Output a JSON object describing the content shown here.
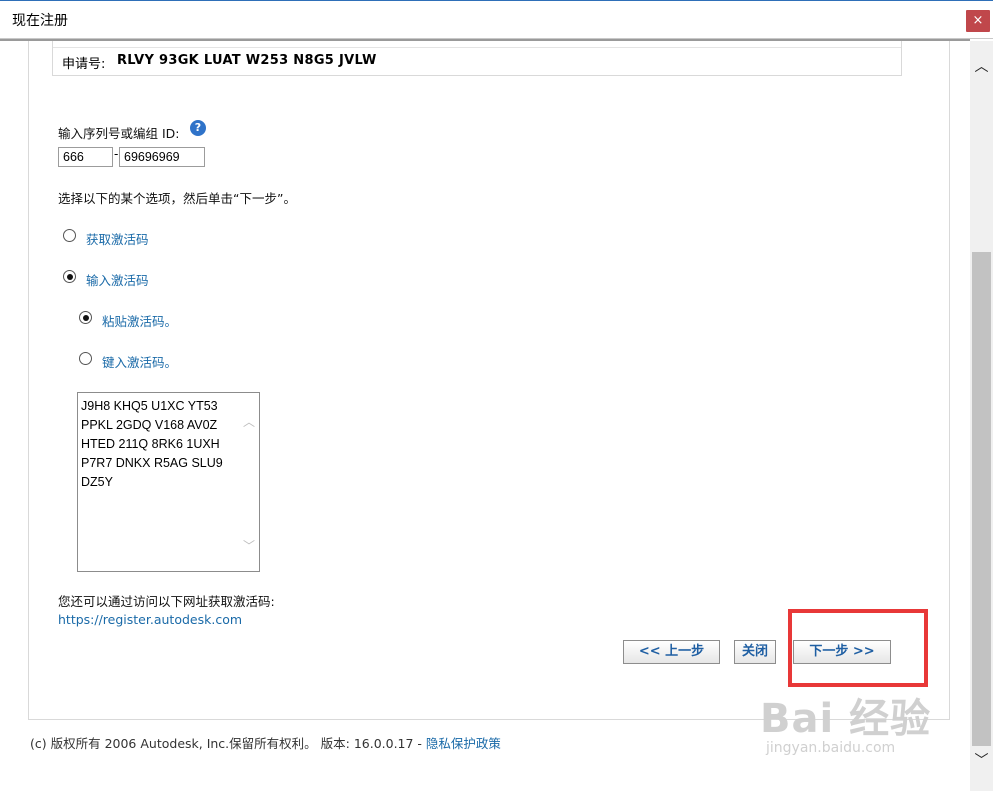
{
  "window": {
    "title": "现在注册",
    "close_icon": "×"
  },
  "request": {
    "label": "申请号:",
    "value": "RLVY 93GK LUAT W253 N8G5 JVLW"
  },
  "serial": {
    "label": "输入序列号或编组 ID:",
    "help_icon": "?",
    "prefix_value": "666",
    "separator": "-",
    "number_value": "69696969"
  },
  "instruction": "选择以下的某个选项，然后单击“下一步”。",
  "options": {
    "get_code": "获取激活码",
    "enter_code": "输入激活码",
    "paste_code": "粘贴激活码。",
    "type_code": "键入激活码。"
  },
  "activation_code": {
    "lines": [
      "J9H8 KHQ5 U1XC YT53",
      "PPKL 2GDQ V168 AV0Z",
      "HTED 211Q 8RK6 1UXH",
      "P7R7 DNKX R5AG SLU9",
      "DZ5Y"
    ],
    "scroll_up_icon": "︿",
    "scroll_down_icon": "﹀"
  },
  "web_hint": {
    "text": "您还可以通过访问以下网址获取激活码:",
    "url": "https://register.autodesk.com"
  },
  "buttons": {
    "back": "<< 上一步",
    "close": "关闭",
    "next": "下一步 >>"
  },
  "footer": {
    "copyright": "(c) 版权所有 2006 Autodesk, Inc.保留所有权利。 版本: 16.0.0.17 - ",
    "privacy_link": "隐私保护政策"
  },
  "watermark": {
    "main": "Bai  经验",
    "sub": "jingyan.baidu.com"
  },
  "scrollbar": {
    "up_icon": "︿",
    "down_icon": "﹀"
  },
  "colors": {
    "link": "#1a6aa8",
    "close_button": "#c0474b",
    "highlight": "#e83838"
  }
}
